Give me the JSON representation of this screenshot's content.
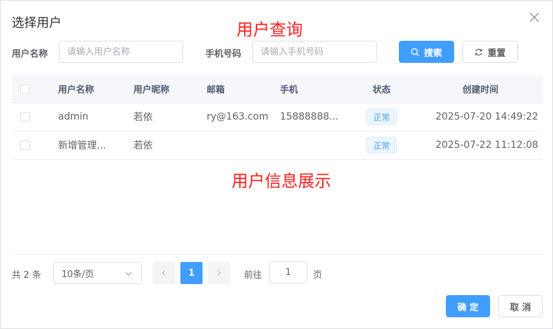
{
  "dialog": {
    "title": "选择用户"
  },
  "annotations": {
    "query": "用户查询",
    "info": "用户信息展示"
  },
  "search": {
    "username_label": "用户名称",
    "username_placeholder": "请输入用户名称",
    "phone_label": "手机号码",
    "phone_placeholder": "请输入手机号码",
    "search_label": "搜索",
    "reset_label": "重置"
  },
  "table": {
    "headers": {
      "username": "用户名称",
      "nickname": "用户昵称",
      "email": "邮箱",
      "phone": "手机",
      "status": "状态",
      "created": "创建时间"
    },
    "rows": [
      {
        "username": "admin",
        "nickname": "若依",
        "email": "ry@163.com",
        "phone": "15888888...",
        "status": "正常",
        "created": "2025-07-20 14:49:22"
      },
      {
        "username": "新增管理...",
        "nickname": "若依",
        "email": "",
        "phone": "",
        "status": "正常",
        "created": "2025-07-22 11:12:08"
      }
    ]
  },
  "pagination": {
    "total_text": "共 2 条",
    "page_size": "10条/页",
    "current_page": "1",
    "goto_label": "前往",
    "goto_value": "1",
    "page_suffix": "页"
  },
  "footer": {
    "confirm_label": "确 定",
    "cancel_label": "取 消"
  },
  "colors": {
    "primary": "#409eff",
    "annotation": "#ff1f1f"
  }
}
